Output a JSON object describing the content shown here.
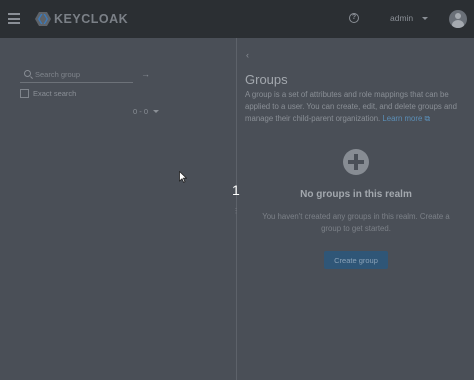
{
  "header": {
    "brand": "KEYCLOAK",
    "user": "admin"
  },
  "left_panel": {
    "search_placeholder": "Search group",
    "exact_search_label": "Exact search",
    "pagination": "0 - 0"
  },
  "overlay": {
    "step_number": "1"
  },
  "main": {
    "title": "Groups",
    "description": "A group is a set of attributes and role mappings that can be applied to a user. You can create, edit, and delete groups and manage their child-parent organization.",
    "learn_more": "Learn more",
    "empty_title": "No groups in this realm",
    "empty_body": "You haven't created any groups in this realm. Create a group to get started.",
    "create_button": "Create group"
  },
  "colors": {
    "header_bg": "#2b2f33",
    "page_bg": "#4a4f57",
    "link": "#5b8fb8",
    "primary_button": "#2f5677"
  },
  "icons": {
    "menu": "hamburger-icon",
    "help": "help-icon",
    "search": "search-icon",
    "go": "arrow-right-icon",
    "back": "chevron-left-icon",
    "external": "external-link-icon",
    "empty": "plus-circle-icon"
  }
}
